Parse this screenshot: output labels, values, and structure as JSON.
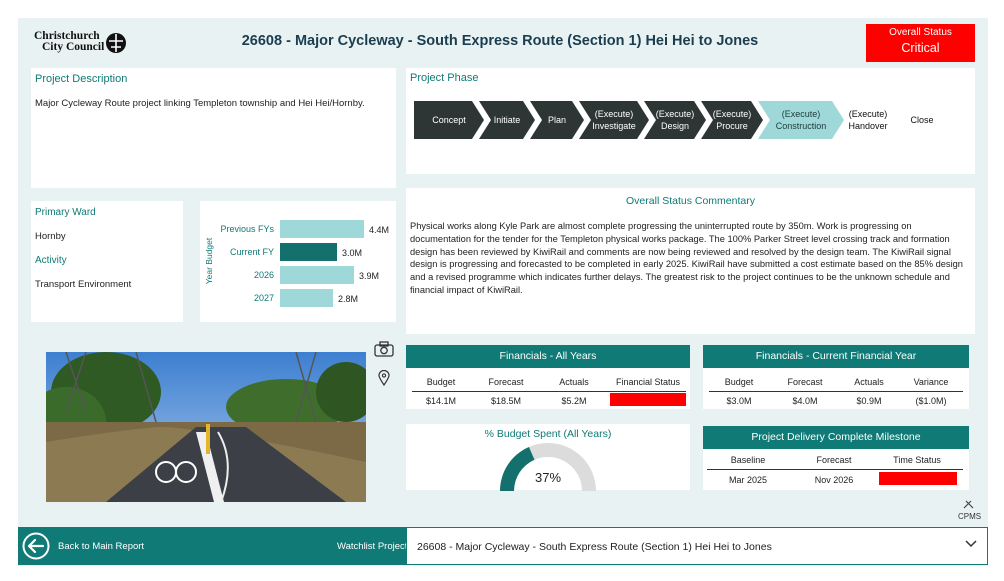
{
  "header": {
    "logo_line1": "Christchurch",
    "logo_line2": "City Council",
    "title": "26608 - Major Cycleway - South Express Route (Section 1) Hei Hei to Jones",
    "status_label": "Overall Status",
    "status_value": "Critical",
    "status_color": "#ff0000"
  },
  "description": {
    "title": "Project Description",
    "text": "Major Cycleway Route project linking Templeton township and Hei Hei/Hornby."
  },
  "phase": {
    "title": "Project Phase",
    "steps": [
      {
        "label": "Concept",
        "sub": "",
        "state": "done"
      },
      {
        "label": "Initiate",
        "sub": "",
        "state": "done"
      },
      {
        "label": "Plan",
        "sub": "",
        "state": "done"
      },
      {
        "label": "(Execute)",
        "sub": "Investigate",
        "state": "done"
      },
      {
        "label": "(Execute)",
        "sub": "Design",
        "state": "done"
      },
      {
        "label": "(Execute)",
        "sub": "Procure",
        "state": "done"
      },
      {
        "label": "(Execute)",
        "sub": "Construction",
        "state": "current"
      },
      {
        "label": "(Execute)",
        "sub": "Handover",
        "state": "future"
      },
      {
        "label": "Close",
        "sub": "",
        "state": "future"
      }
    ]
  },
  "ward": {
    "ward_label": "Primary Ward",
    "ward_value": "Hornby",
    "activity_label": "Activity",
    "activity_value": "Transport Environment"
  },
  "chart_data": {
    "type": "bar",
    "orientation": "horizontal",
    "ylabel": "Year Budget",
    "categories": [
      "Previous FYs",
      "Current FY",
      "2026",
      "2027"
    ],
    "values": [
      4.4,
      3.0,
      3.9,
      2.8
    ],
    "value_labels": [
      "4.4M",
      "3.0M",
      "3.9M",
      "2.8M"
    ],
    "unit": "M",
    "highlight": "Current FY",
    "colors": {
      "default": "#9fd8d8",
      "highlight": "#14706d"
    }
  },
  "commentary": {
    "title": "Overall Status Commentary",
    "text": "Physical works along Kyle Park are almost complete progressing the uninterrupted route by 350m. Work is progressing on documentation for the tender for the Templeton physical works package. The 100% Parker Street level crossing track and formation design has been reviewed by KiwiRail and comments are now being reviewed and resolved by the design team. The KiwiRail signal design is progressing and forecasted to be completed in early 2025. KiwiRail have submitted a cost estimate based on the 85% design and a revised programme which indicates further delays. The greatest risk to the project continues to be the unknown schedule and financial impact of KiwiRail."
  },
  "icons": {
    "camera": "camera-icon",
    "location": "map-pin-icon",
    "cpms_label": "CPMS"
  },
  "fin_all": {
    "title": "Financials - All Years",
    "headers": [
      "Budget",
      "Forecast",
      "Actuals",
      "Financial Status"
    ],
    "values": [
      "$14.1M",
      "$18.5M",
      "$5.2M",
      ""
    ],
    "status_color": "#ff0000"
  },
  "fin_current": {
    "title": "Financials - Current Financial Year",
    "headers": [
      "Budget",
      "Forecast",
      "Actuals",
      "Variance"
    ],
    "values": [
      "$3.0M",
      "$4.0M",
      "$0.9M",
      "($1.0M)"
    ]
  },
  "gauge": {
    "title": "% Budget Spent (All Years)",
    "value": 37,
    "label": "37%"
  },
  "milestone": {
    "title": "Project Delivery Complete Milestone",
    "headers": [
      "Baseline",
      "Forecast",
      "Time Status"
    ],
    "values": [
      "Mar 2025",
      "Nov 2026",
      ""
    ],
    "status_color": "#ff0000"
  },
  "footer": {
    "back_label": "Back to Main Report",
    "watchlist_label": "Watchlist Project:",
    "watchlist_value": "26608 - Major Cycleway - South Express Route (Section 1) Hei Hei to Jones"
  }
}
